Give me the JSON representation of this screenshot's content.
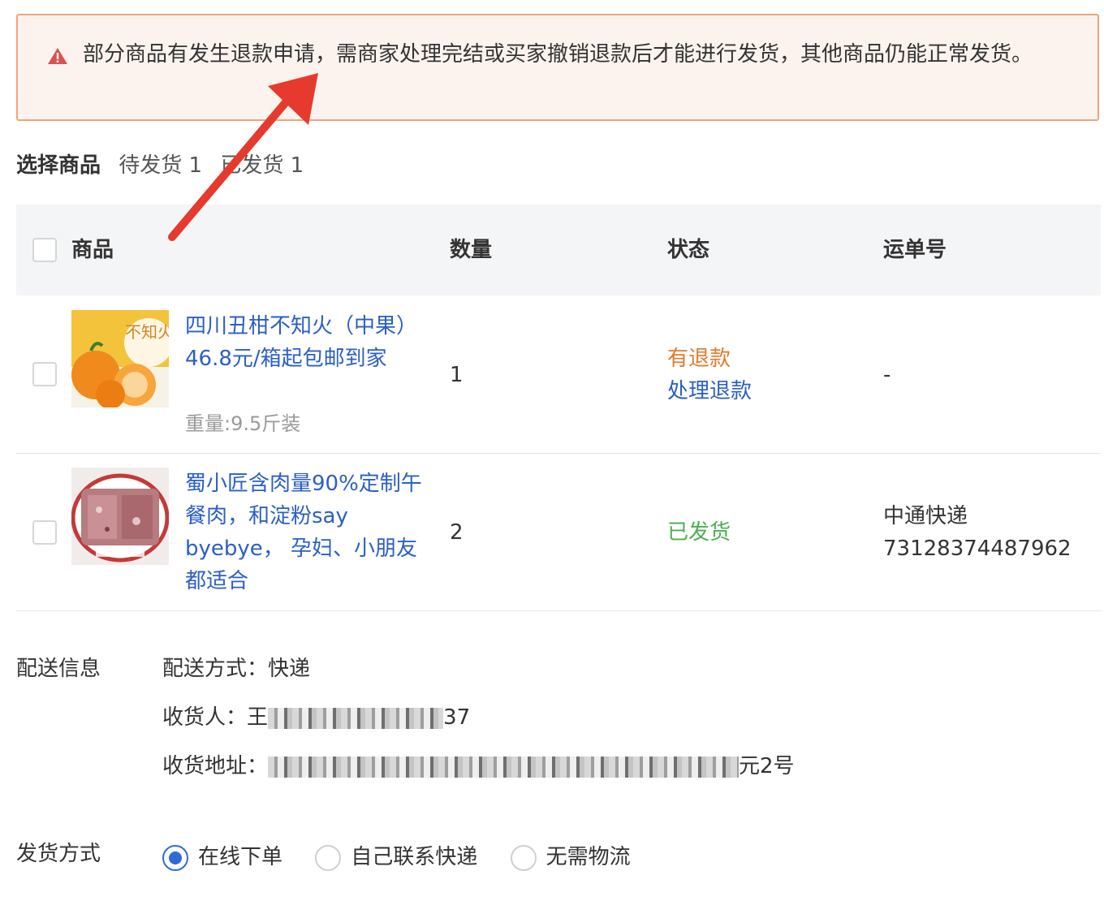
{
  "alert": {
    "icon": "warning-icon",
    "color": "#d9534f",
    "text": "部分商品有发生退款申请，需商家处理完结或买家撤销退款后才能进行发货，其他商品仍能正常发货。"
  },
  "selection": {
    "title": "选择商品",
    "pending": "待发货 1",
    "shipped": "已发货 1"
  },
  "table": {
    "headers": {
      "product": "商品",
      "quantity": "数量",
      "status": "状态",
      "waybill": "运单号"
    },
    "rows": [
      {
        "title": "四川丑柑不知火（中果） 46.8元/箱起包邮到家",
        "spec": "重量:9.5斤装",
        "quantity": "1",
        "status": "有退款",
        "status_color": "#e07a2e",
        "action": "处理退款",
        "waybill": "-",
        "thumb_label": "不知火"
      },
      {
        "title": "蜀小匠含肉量90%定制午餐肉，和淀粉say byebye， 孕妇、小朋友都适合",
        "quantity": "2",
        "status": "已发货",
        "status_color": "#4caf50",
        "courier": "中通快递",
        "waybill": "73128374487962"
      }
    ]
  },
  "delivery": {
    "label": "配送信息",
    "method": "配送方式：快递",
    "receiver_label": "收货人：",
    "receiver_visible_start": "王",
    "receiver_visible_end": "37",
    "address_label": "收货地址：",
    "address_visible_end": "元2号"
  },
  "shipping": {
    "label": "发货方式",
    "options": [
      {
        "label": "在线下单",
        "checked": true
      },
      {
        "label": "自己联系快递",
        "checked": false
      },
      {
        "label": "无需物流",
        "checked": false
      }
    ],
    "accent": "#2f6bd8"
  },
  "annotation": {
    "arrow_color": "#e53a2d"
  }
}
